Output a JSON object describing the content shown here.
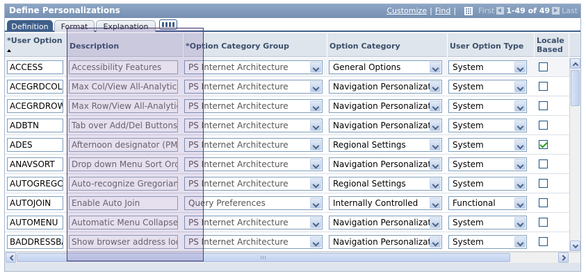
{
  "header": {
    "title": "Define Personalizations",
    "customize": "Customize",
    "find": "Find",
    "first": "First",
    "range": "1-49 of 49",
    "last": "Last"
  },
  "tabs": [
    {
      "label": "Definition"
    },
    {
      "label": "Format"
    },
    {
      "label": "Explanation"
    }
  ],
  "columns": {
    "user_option_req": "*",
    "user_option": "User Option",
    "description": "Description",
    "option_category_group": "*Option Category Group",
    "option_category": "Option Category",
    "user_option_type": "User Option Type",
    "locale_based": "Locale Based"
  },
  "rows": [
    {
      "user_option": "ACCESS",
      "description": "Accessibility Features",
      "group": "PS Internet Architecture",
      "category": "General Options",
      "type": "System",
      "locale": false
    },
    {
      "user_option": "ACEGRDCOL",
      "description": "Max Col/View All-Analytic Grid",
      "group": "PS Internet Architecture",
      "category": "Navigation Personalizatio",
      "type": "System",
      "locale": false
    },
    {
      "user_option": "ACEGRDROW",
      "description": "Max Row/View All-Analytic Gr",
      "group": "PS Internet Architecture",
      "category": "Navigation Personalizatio",
      "type": "System",
      "locale": false
    },
    {
      "user_option": "ADBTN",
      "description": "Tab over Add/Del Buttons (+/-)",
      "group": "PS Internet Architecture",
      "category": "Navigation Personalizatio",
      "type": "System",
      "locale": false
    },
    {
      "user_option": "ADES",
      "description": "Afternoon designator (PM, pm)",
      "group": "PS Internet Architecture",
      "category": "Regional Settings",
      "type": "System",
      "locale": true
    },
    {
      "user_option": "ANAVSORT",
      "description": "Drop down Menu Sort Order",
      "group": "PS Internet Architecture",
      "category": "Navigation Personalizatio",
      "type": "System",
      "locale": false
    },
    {
      "user_option": "AUTOGREGC",
      "description": "Auto-recognize Gregorian da",
      "group": "PS Internet Architecture",
      "category": "Regional Settings",
      "type": "System",
      "locale": false
    },
    {
      "user_option": "AUTOJOIN",
      "description": "Enable Auto Join",
      "group": "Query Preferences",
      "category": "Internally Controlled",
      "type": "Functional",
      "locale": false
    },
    {
      "user_option": "AUTOMENU",
      "description": "Automatic Menu Collapse",
      "group": "PS Internet Architecture",
      "category": "Navigation Personalizatio",
      "type": "System",
      "locale": false
    },
    {
      "user_option": "BADDRESSBA",
      "description": "Show browser address locat",
      "group": "PS Internet Architecture",
      "category": "Navigation Personalizatio",
      "type": "System",
      "locale": false
    }
  ]
}
